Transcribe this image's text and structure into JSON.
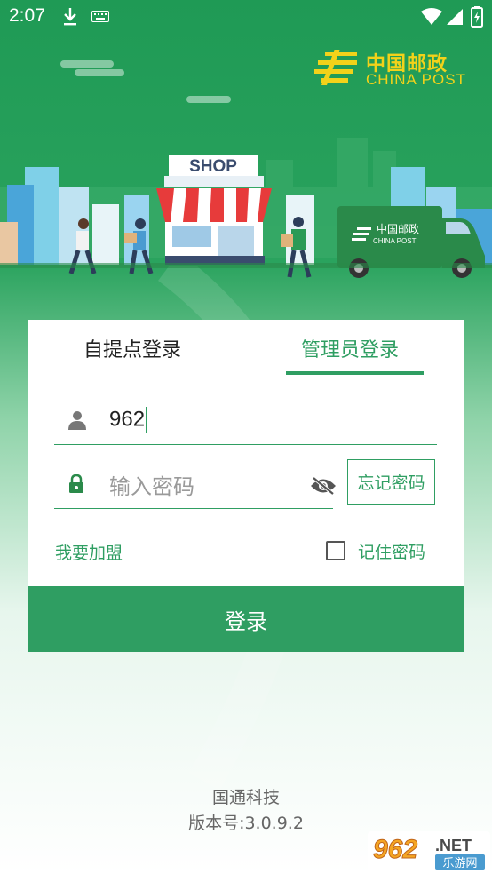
{
  "status_bar": {
    "time": "2:07"
  },
  "brand": {
    "name_cn": "中国邮政",
    "name_en": "CHINA POST"
  },
  "hero": {
    "shop_sign": "SHOP",
    "truck_text_cn": "中国邮政",
    "truck_text_en": "CHINA POST"
  },
  "tabs": [
    {
      "label": "自提点登录",
      "active": false
    },
    {
      "label": "管理员登录",
      "active": true
    }
  ],
  "form": {
    "username_value": "962",
    "password_placeholder": "输入密码",
    "forgot_label": "忘记密码",
    "join_label": "我要加盟",
    "remember_label": "记住密码",
    "login_label": "登录"
  },
  "footer": {
    "company": "国通科技",
    "version": "版本号:3.0.9.2"
  },
  "watermark": {
    "brand": "962",
    "suffix": ".NET",
    "sub": "乐游网"
  },
  "colors": {
    "primary": "#2f9e62",
    "brand_yellow": "#f2d21a"
  }
}
